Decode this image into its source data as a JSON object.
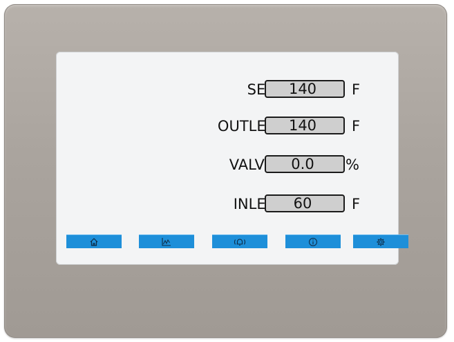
{
  "readings": [
    {
      "label": "SETPOINT",
      "value": "140",
      "unit": "F"
    },
    {
      "label": "OUTLET TEMP",
      "value": "140",
      "unit": "F"
    },
    {
      "label": "VALVE OPEN",
      "value": "0.0",
      "unit": "%"
    },
    {
      "label": "INLET TEMP",
      "value": "60",
      "unit": "F"
    }
  ],
  "navbar": {
    "buttons": [
      {
        "icon": "home-icon"
      },
      {
        "icon": "trend-chart-icon"
      },
      {
        "icon": "alarm-bell-icon"
      },
      {
        "icon": "info-icon"
      },
      {
        "icon": "gear-icon"
      }
    ]
  },
  "colors": {
    "bezel": "#aaa49e",
    "screen": "#f3f4f5",
    "value_box": "#cfcfcf",
    "nav_button": "#1e8fd9"
  }
}
